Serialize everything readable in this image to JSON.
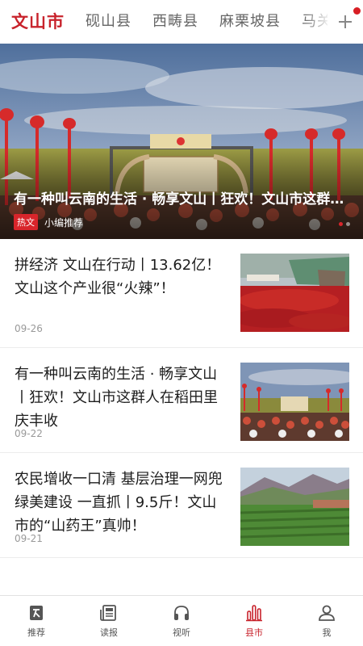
{
  "top_tabs": {
    "items": [
      "文山市",
      "砚山县",
      "西畴县",
      "麻栗坡县",
      "马关"
    ],
    "active_index": 0,
    "add_icon": "plus-icon",
    "notification_dot_color": "#d81e24"
  },
  "banner": {
    "title": "有一种叫云南的生活 · 畅享文山丨狂欢！文山市这群人在稻田里庆丰收",
    "badge": "热文",
    "tag": "小编推荐",
    "sign_text": "庆丰收 迎国庆"
  },
  "news": [
    {
      "title": "拼经济 文山在行动丨13.62亿！文山这个产业很“火辣”！",
      "date": "09-26",
      "image": "chili-harvest-image"
    },
    {
      "title": "有一种叫云南的生活 · 畅享文山丨狂欢！文山市这群人在稻田里庆丰收",
      "date": "09-22",
      "image": "harvest-festival-image"
    },
    {
      "title": "农民增收一口清 基层治理一网兜 绿美建设 一直抓丨9.5斤！文山市的“山药王”真帅！",
      "date": "09-21",
      "image": "farmland-hills-image"
    }
  ],
  "bottom_nav": {
    "items": [
      {
        "label": "推荐",
        "icon": "recommend-icon"
      },
      {
        "label": "读报",
        "icon": "newspaper-icon"
      },
      {
        "label": "视听",
        "icon": "headphones-icon"
      },
      {
        "label": "县市",
        "icon": "county-icon"
      },
      {
        "label": "我",
        "icon": "user-icon"
      }
    ],
    "active_index": 3
  },
  "colors": {
    "accent": "#c8232c",
    "text": "#1d1d1d",
    "muted": "#999999"
  }
}
